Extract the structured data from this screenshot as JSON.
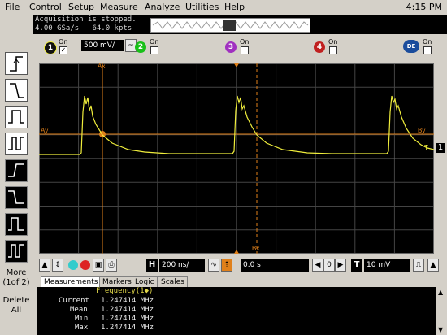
{
  "menu": {
    "items": [
      "File",
      "Control",
      "Setup",
      "Measure",
      "Analyze",
      "Utilities",
      "Help"
    ],
    "clock": "4:15 PM"
  },
  "status": {
    "line1": "Acquisition is stopped.",
    "line2": "4.00 GSa/s   64.0 kpts"
  },
  "channels": {
    "ch1": {
      "num": "1",
      "on_label": "On",
      "scale": "500 mV/",
      "color": "#f0ee3c"
    },
    "ch2": {
      "num": "2",
      "on_label": "On",
      "color": "#18c018"
    },
    "ch3": {
      "num": "3",
      "on_label": "On",
      "color": "#a030c0"
    },
    "ch4": {
      "num": "4",
      "on_label": "On",
      "color": "#c02020"
    },
    "de": {
      "on_label": "On",
      "label": "DE"
    }
  },
  "left_panel": {
    "more_label": "More\n(1of 2)",
    "more_l1": "More",
    "more_l2": "(1of 2)",
    "delete_l1": "Delete",
    "delete_l2": "All"
  },
  "graticule": {
    "marker_ax": "Ax",
    "marker_bx": "Bx",
    "marker_ay": "Ay",
    "marker_by": "By",
    "trace_color": "#f0ee3c",
    "marker_color": "#e0801a"
  },
  "toolbar": {
    "h_label": "H",
    "timebase": "200 ns/",
    "delay": "0.0 s",
    "t_label": "T",
    "trigger_level": "10 mV"
  },
  "measurements": {
    "tabs": [
      "Measurements",
      "Markers",
      "Logic",
      "Scales"
    ],
    "heading": "Frequency(1◆)",
    "rows": [
      {
        "label": "Current",
        "value": "1.247414 MHz"
      },
      {
        "label": "Mean",
        "value": "1.247414 MHz"
      },
      {
        "label": "Min",
        "value": "1.247414 MHz"
      },
      {
        "label": "Max",
        "value": "1.247414 MHz"
      }
    ]
  }
}
